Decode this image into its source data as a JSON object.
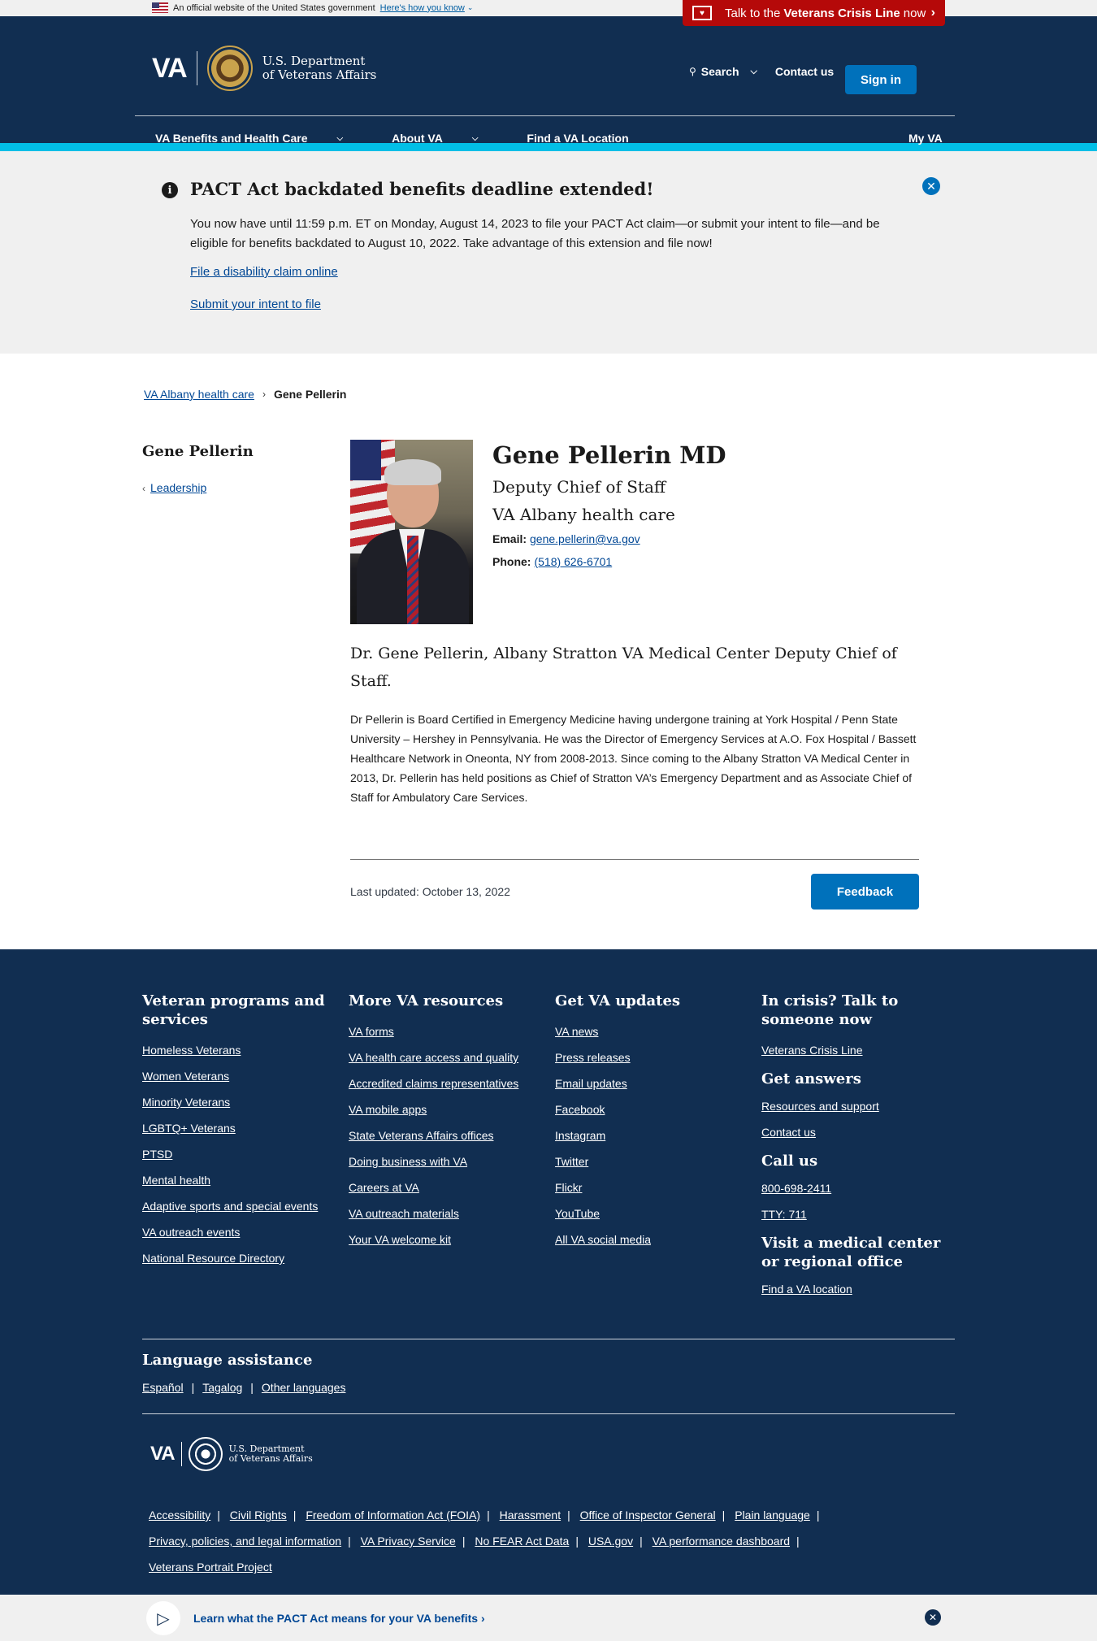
{
  "official_banner": {
    "text": "An official website of the United States government",
    "link": "Here's how you know"
  },
  "crisis_line": {
    "prefix": "Talk to the",
    "bold": "Veterans Crisis Line",
    "suffix": "now"
  },
  "header": {
    "logo_text": "VA",
    "dept_line1": "U.S. Department",
    "dept_line2": "of Veterans Affairs",
    "search": "Search",
    "contact": "Contact us",
    "signin": "Sign in",
    "nav": [
      "VA Benefits and Health Care",
      "About VA",
      "Find a VA Location"
    ],
    "myva": "My VA"
  },
  "alert": {
    "title": "PACT Act backdated benefits deadline extended!",
    "body": "You now have until 11:59 p.m. ET on Monday, August 14, 2023 to file your PACT Act claim—or submit your intent to file—and be eligible for benefits backdated to August 10, 2022. Take advantage of this extension and file now!",
    "link1": "File a disability claim online",
    "link2": "Submit your intent to file"
  },
  "breadcrumb": {
    "parent": "VA Albany health care",
    "current": "Gene Pellerin"
  },
  "sidebar": {
    "title": "Gene Pellerin",
    "link": "Leadership"
  },
  "profile": {
    "name": "Gene Pellerin MD",
    "title": "Deputy Chief of Staff",
    "org": "VA Albany health care",
    "email_label": "Email:",
    "email": "gene.pellerin@va.gov",
    "phone_label": "Phone:",
    "phone": "(518) 626-6701",
    "intro": "Dr. Gene Pellerin, Albany Stratton VA Medical Center Deputy Chief of Staff.",
    "bio": "Dr Pellerin is Board Certified in Emergency Medicine having undergone training at York Hospital / Penn State University – Hershey in Pennsylvania. He was the Director of Emergency Services at A.O. Fox Hospital / Bassett Healthcare Network in Oneonta, NY from 2008-2013.  Since coming to the Albany Stratton VA Medical Center in 2013, Dr. Pellerin has held positions as Chief of Stratton VA’s Emergency Department and as Associate Chief of Staff for Ambulatory Care Services.",
    "last_updated": "Last updated: October 13, 2022",
    "feedback": "Feedback"
  },
  "footer": {
    "col1": {
      "title": "Veteran programs and services",
      "links": [
        "Homeless Veterans",
        "Women Veterans",
        "Minority Veterans",
        "LGBTQ+ Veterans",
        "PTSD",
        "Mental health",
        "Adaptive sports and special events",
        "VA outreach events",
        "National Resource Directory"
      ]
    },
    "col2": {
      "title": "More VA resources",
      "links": [
        "VA forms",
        "VA health care access and quality",
        "Accredited claims representatives",
        "VA mobile apps",
        "State Veterans Affairs offices",
        "Doing business with VA",
        "Careers at VA",
        "VA outreach materials",
        "Your VA welcome kit"
      ]
    },
    "col3": {
      "title": "Get VA updates",
      "links": [
        "VA news",
        "Press releases",
        "Email updates",
        "Facebook",
        "Instagram",
        "Twitter",
        "Flickr",
        "YouTube",
        "All VA social media"
      ]
    },
    "col4": {
      "title": "In crisis? Talk to someone now",
      "crisis_link": "Veterans Crisis Line",
      "answers_title": "Get answers",
      "answers_links": [
        "Resources and support",
        "Contact us"
      ],
      "call_title": "Call us",
      "call_links": [
        "800-698-2411",
        "TTY: 711"
      ],
      "visit_title": "Visit a medical center or regional office",
      "visit_link": "Find a VA location"
    },
    "language_title": "Language assistance",
    "languages": [
      "Español",
      "Tagalog",
      "Other languages"
    ],
    "logo_text": "VA",
    "dept_line1": "U.S. Department",
    "dept_line2": "of Veterans Affairs",
    "bottom_links": [
      "Accessibility",
      "Civil Rights",
      "Freedom of Information Act (FOIA)",
      "Harassment",
      "Office of Inspector General",
      "Plain language",
      "Privacy, policies, and legal information",
      "VA Privacy Service",
      "No FEAR Act Data",
      "USA.gov",
      "VA performance dashboard",
      "Veterans Portrait Project"
    ]
  },
  "promo": {
    "text": "Learn what the PACT Act means for your VA benefits"
  },
  "icons": {
    "info": "info-icon",
    "close": "close-icon",
    "search": "search-icon",
    "megaphone": "megaphone-icon"
  },
  "colors": {
    "header_bg": "#112e51",
    "accent_stripe": "#02bfe7",
    "button_blue": "#0071bb",
    "crisis_red": "#b50909",
    "link_blue": "#004795"
  }
}
